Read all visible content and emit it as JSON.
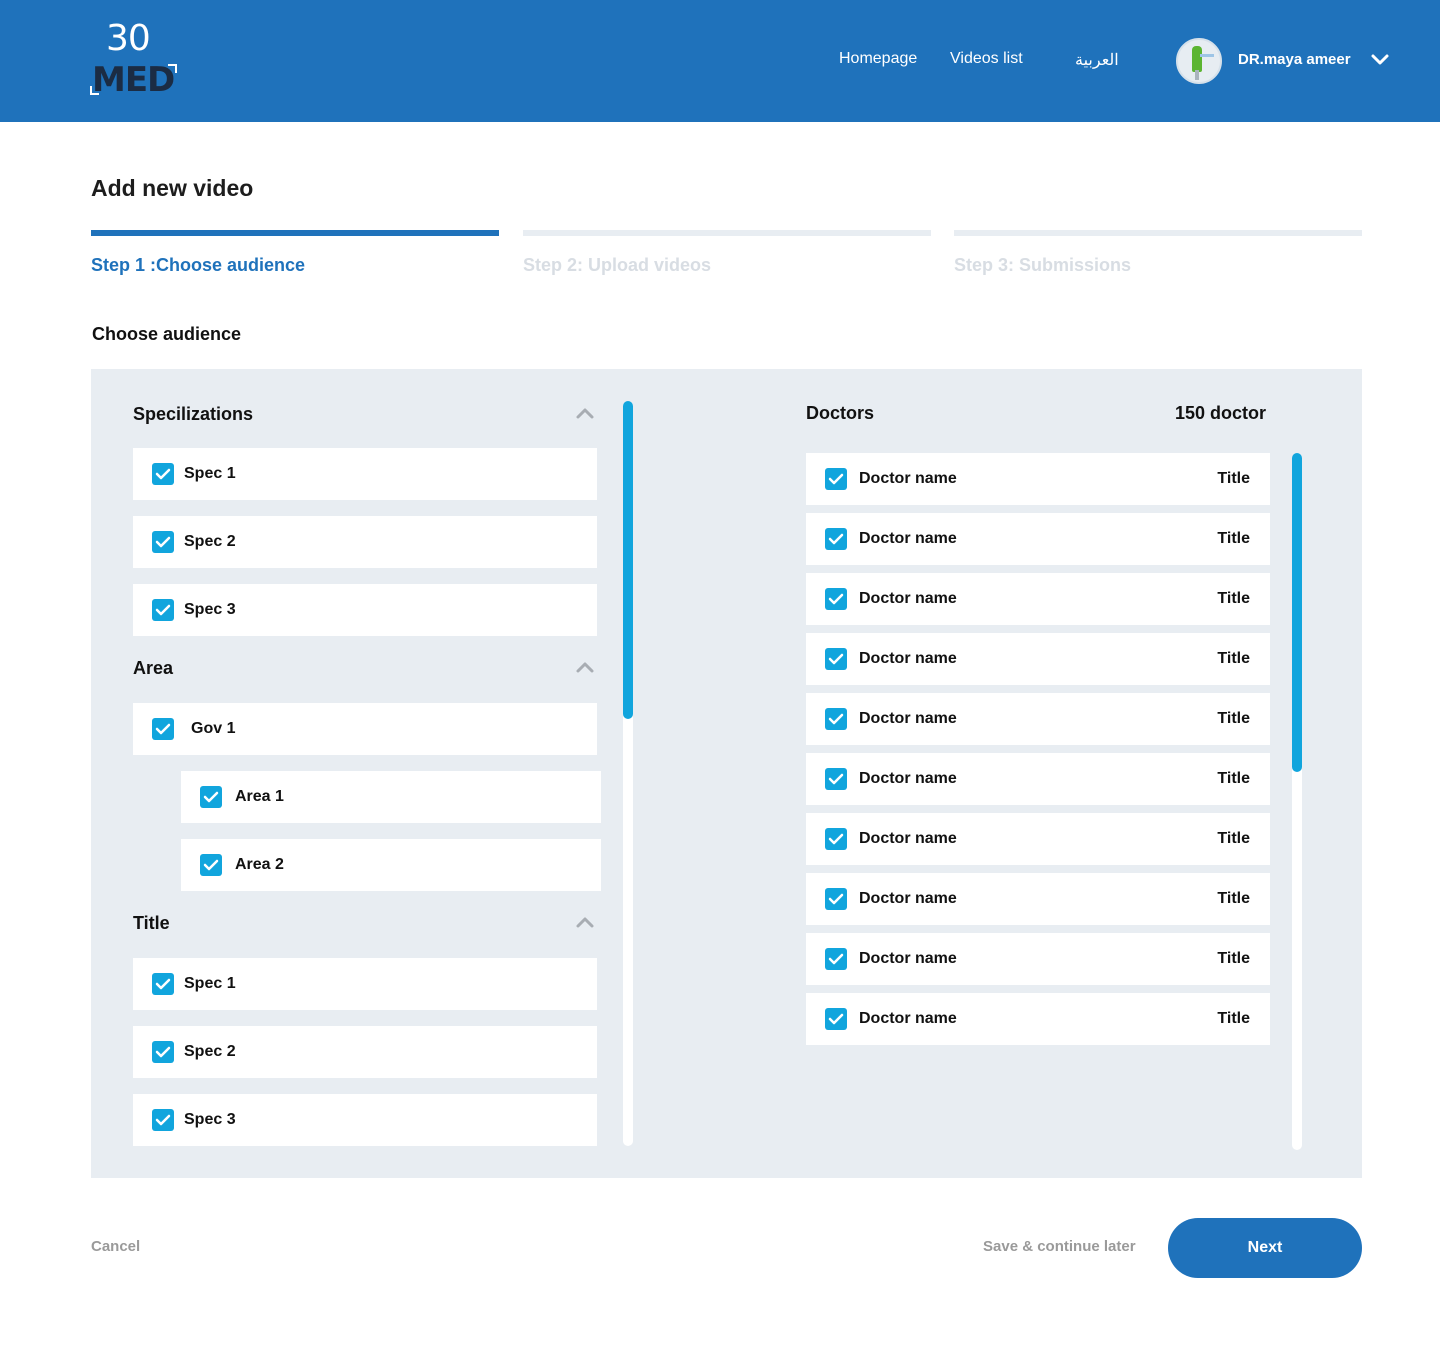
{
  "header": {
    "logo_number": "30",
    "logo_text": "MED",
    "nav": [
      "Homepage",
      "Videos list",
      "العربية"
    ],
    "username": "DR.maya ameer"
  },
  "page": {
    "title": "Add new video",
    "steps": [
      {
        "label": "Step 1 :Choose audience",
        "active": true
      },
      {
        "label": "Step 2: Upload videos",
        "active": false
      },
      {
        "label": "Step 3: Submissions",
        "active": false
      }
    ],
    "section_title": "Choose audience"
  },
  "filters": {
    "specializations": {
      "title": "Specilizations",
      "items": [
        "Spec 1",
        "Spec 2",
        "Spec 3"
      ]
    },
    "area": {
      "title": "Area",
      "gov": "Gov 1",
      "items": [
        "Area 1",
        "Area 2"
      ]
    },
    "title_group": {
      "title": "Title",
      "items": [
        "Spec 1",
        "Spec 2",
        "Spec 3"
      ]
    }
  },
  "doctors": {
    "title": "Doctors",
    "count": "150 doctor",
    "rows": [
      {
        "name": "Doctor name",
        "title": "Title"
      },
      {
        "name": "Doctor name",
        "title": "Title"
      },
      {
        "name": "Doctor name",
        "title": "Title"
      },
      {
        "name": "Doctor name",
        "title": "Title"
      },
      {
        "name": "Doctor name",
        "title": "Title"
      },
      {
        "name": "Doctor name",
        "title": "Title"
      },
      {
        "name": "Doctor name",
        "title": "Title"
      },
      {
        "name": "Doctor name",
        "title": "Title"
      },
      {
        "name": "Doctor name",
        "title": "Title"
      },
      {
        "name": "Doctor name",
        "title": "Title"
      }
    ]
  },
  "footer": {
    "cancel": "Cancel",
    "save_later": "Save & continue later",
    "next": "Next"
  },
  "colors": {
    "primary": "#1f72bb",
    "accent": "#11a5dd",
    "panel_bg": "#e8edf2"
  }
}
